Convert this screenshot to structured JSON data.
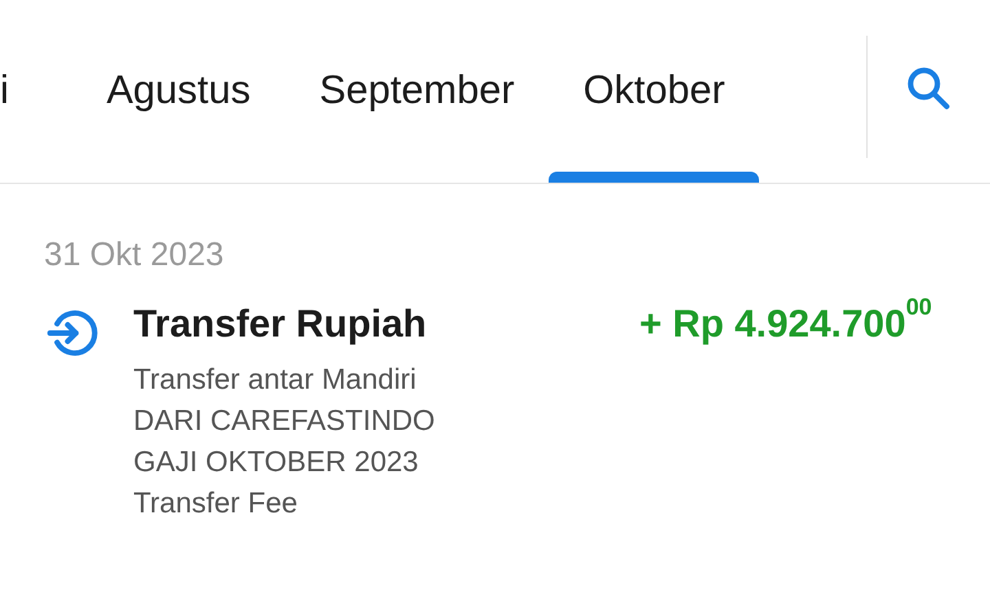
{
  "tabs": [
    {
      "label": "i",
      "selected": false
    },
    {
      "label": "Agustus",
      "selected": false
    },
    {
      "label": "September",
      "selected": false
    },
    {
      "label": "Oktober",
      "selected": true
    }
  ],
  "date": "31 Okt 2023",
  "transactions": [
    {
      "title": "Transfer Rupiah",
      "amount": "+ Rp 4.924.700$^{00}$",
      "incoming": true,
      "details": [
        "Transfer antar Mandiri",
        "DARI CAREFASTINDO",
        "GAJI OKTOBER 2023",
        "Transfer Fee"
      ]
    }
  ]
}
